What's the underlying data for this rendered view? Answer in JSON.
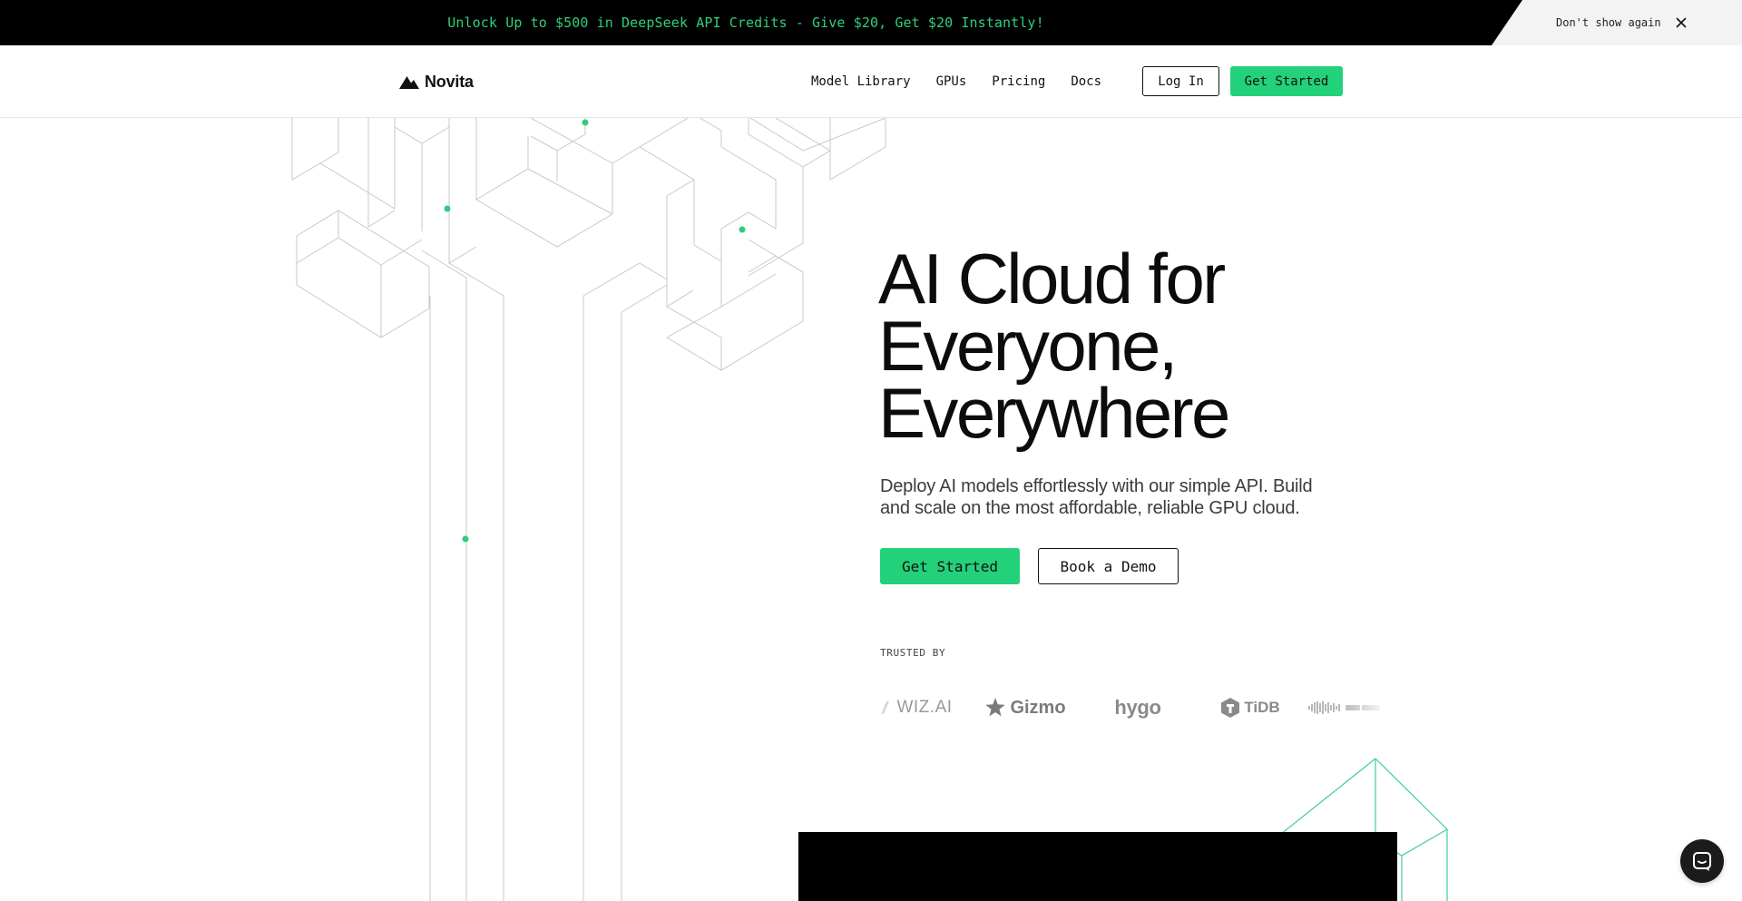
{
  "promo": {
    "text": "Unlock Up to $500 in DeepSeek API Credits - Give $20, Get $20 Instantly!",
    "dismiss_label": "Don't show again",
    "close_icon": "close-icon"
  },
  "header": {
    "brand": "Novita",
    "nav": [
      "Model Library",
      "GPUs",
      "Pricing",
      "Docs"
    ],
    "login_label": "Log In",
    "get_started_label": "Get Started"
  },
  "hero": {
    "title_lines": [
      "AI Cloud for",
      "Everyone,",
      "Everywhere"
    ],
    "subtitle": "Deploy AI models effortlessly with our simple API. Build and scale on the most affordable, reliable GPU cloud.",
    "primary_cta": "Get Started",
    "secondary_cta": "Book a Demo"
  },
  "trusted": {
    "label": "TRUSTED BY",
    "logos": [
      "WIZ.AI",
      "Gizmo",
      "hygo",
      "TiDB"
    ]
  },
  "colors": {
    "accent": "#23d17a",
    "promo_text": "#2fd07c",
    "line": "#c9c9c9"
  },
  "chat": {
    "icon": "chat-icon"
  }
}
